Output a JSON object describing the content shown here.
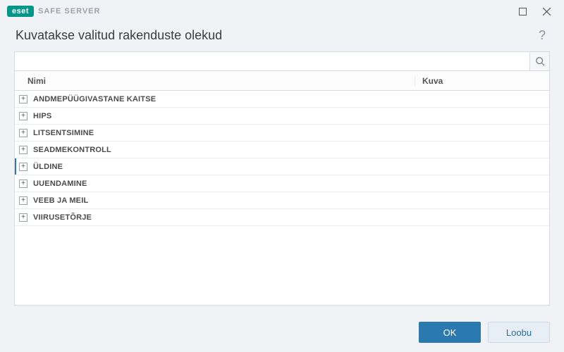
{
  "brand": {
    "name": "eset",
    "product": "SAFE SERVER"
  },
  "header": {
    "title": "Kuvatakse valitud rakenduste olekud",
    "help_symbol": "?"
  },
  "search": {
    "value": ""
  },
  "table": {
    "columns": {
      "name": "Nimi",
      "kuva": "Kuva"
    },
    "rows": [
      {
        "label": "ANDMEPÜÜGIVASTANE KAITSE",
        "selected": false
      },
      {
        "label": "HIPS",
        "selected": false
      },
      {
        "label": "LITSENTSIMINE",
        "selected": false
      },
      {
        "label": "SEADMEKONTROLL",
        "selected": false
      },
      {
        "label": "ÜLDINE",
        "selected": true
      },
      {
        "label": "UUENDAMINE",
        "selected": false
      },
      {
        "label": "VEEB JA MEIL",
        "selected": false
      },
      {
        "label": "VIIRUSETÕRJE",
        "selected": false
      }
    ]
  },
  "footer": {
    "ok": "OK",
    "cancel": "Loobu"
  },
  "icons": {
    "expand_glyph": "+"
  }
}
